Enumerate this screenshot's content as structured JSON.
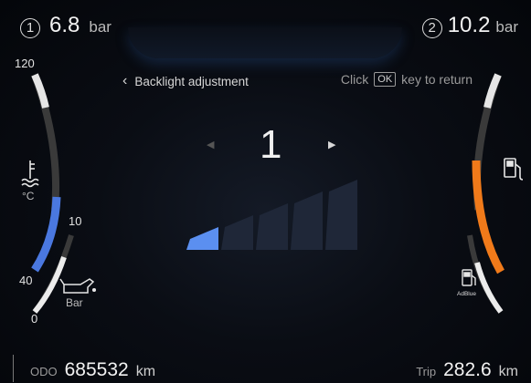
{
  "pressure_1": {
    "index": "1",
    "value": "6.8",
    "unit": "bar"
  },
  "pressure_2": {
    "index": "2",
    "value": "10.2",
    "unit": "bar"
  },
  "menu": {
    "back_glyph": "‹",
    "title": "Backlight adjustment",
    "hint_prefix": "Click",
    "hint_key": "OK",
    "hint_suffix": "key to return",
    "level_value": "1",
    "level_fraction": 0.2,
    "level_steps": 5
  },
  "coolant_gauge": {
    "max_label": "120",
    "unit": "°C",
    "icon": "coolant-temperature-icon",
    "fill_fraction": 0.33,
    "fill_color": "#4a78e0"
  },
  "oil_gauge": {
    "max_label": "10",
    "mid_label": "40",
    "min_label": "0",
    "unit": "Bar",
    "icon": "oil-can-icon"
  },
  "fuel_gauge": {
    "icon": "fuel-pump-icon",
    "fill_fraction": 0.7,
    "fill_color": "#f07a1a"
  },
  "adblue_gauge": {
    "icon": "adblue-pump-icon",
    "label": "AdBlue"
  },
  "odometer": {
    "label": "ODO",
    "value": "685532",
    "unit": "km"
  },
  "trip": {
    "label": "Trip",
    "value": "282.6",
    "unit": "km"
  }
}
